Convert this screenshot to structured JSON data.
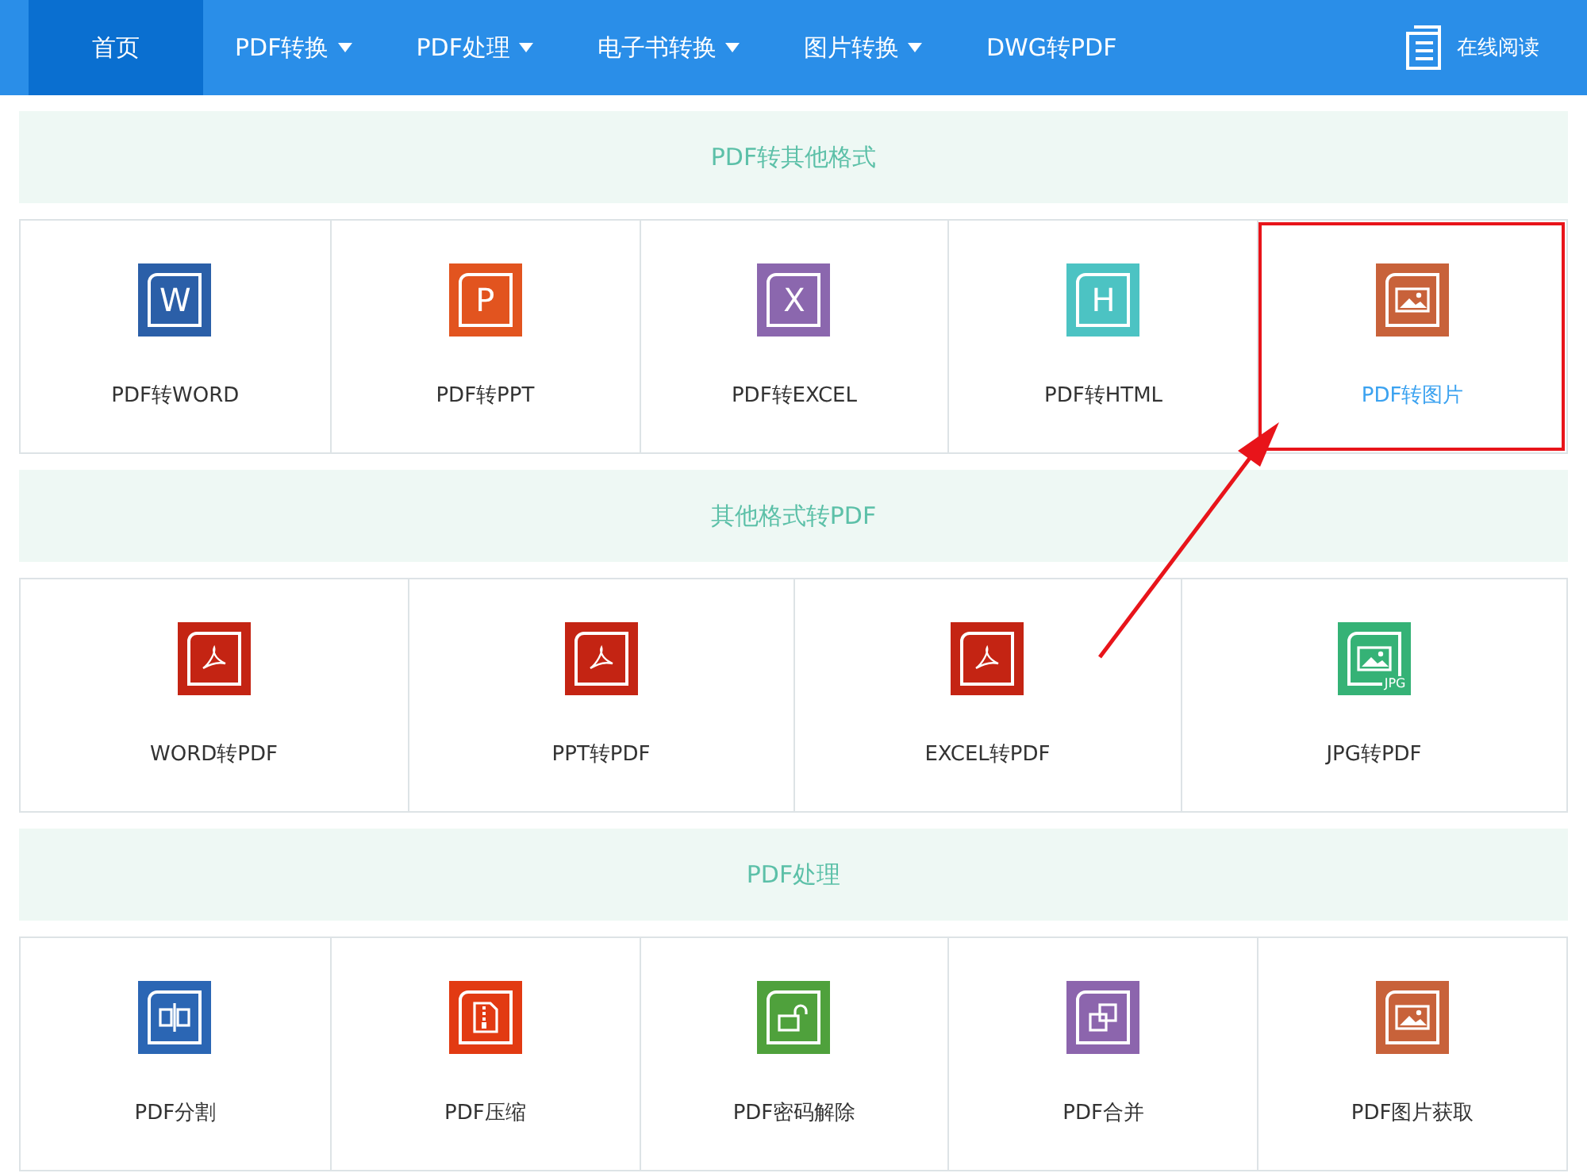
{
  "nav": {
    "items": [
      {
        "label": "首页",
        "selected": true,
        "has_menu": false
      },
      {
        "label": "PDF转换",
        "selected": false,
        "has_menu": true
      },
      {
        "label": "PDF处理",
        "selected": false,
        "has_menu": true
      },
      {
        "label": "电子书转换",
        "selected": false,
        "has_menu": true
      },
      {
        "label": "图片转换",
        "selected": false,
        "has_menu": true
      },
      {
        "label": "DWG转PDF",
        "selected": false,
        "has_menu": false
      }
    ],
    "reader_link": "在线阅读"
  },
  "sections": [
    {
      "title": "PDF转其他格式",
      "tools": [
        {
          "label": "PDF转WORD",
          "kind": "letter",
          "glyph": "W",
          "color": "#2b5fa8",
          "highlighted": false
        },
        {
          "label": "PDF转PPT",
          "kind": "letter",
          "glyph": "P",
          "color": "#e2541f",
          "highlighted": false
        },
        {
          "label": "PDF转EXCEL",
          "kind": "letter",
          "glyph": "X",
          "color": "#8b67ae",
          "highlighted": false
        },
        {
          "label": "PDF转HTML",
          "kind": "letter",
          "glyph": "H",
          "color": "#4cc3c3",
          "highlighted": false
        },
        {
          "label": "PDF转图片",
          "kind": "image",
          "color": "#c8623a",
          "highlighted": true
        }
      ]
    },
    {
      "title": "其他格式转PDF",
      "tools": [
        {
          "label": "WORD转PDF",
          "kind": "pdf",
          "color": "#c42413",
          "highlighted": false
        },
        {
          "label": "PPT转PDF",
          "kind": "pdf",
          "color": "#c42413",
          "highlighted": false
        },
        {
          "label": "EXCEL转PDF",
          "kind": "pdf",
          "color": "#c42413",
          "highlighted": false
        },
        {
          "label": "JPG转PDF",
          "kind": "jpg",
          "glyph": "JPG",
          "color": "#35b276",
          "highlighted": false
        }
      ]
    },
    {
      "title": "PDF处理",
      "tools": [
        {
          "label": "PDF分割",
          "kind": "split",
          "color": "#2b66b4",
          "highlighted": false
        },
        {
          "label": "PDF压缩",
          "kind": "zip",
          "color": "#e23a12",
          "highlighted": false
        },
        {
          "label": "PDF密码解除",
          "kind": "unlock",
          "color": "#4fa13c",
          "highlighted": false
        },
        {
          "label": "PDF合并",
          "kind": "merge",
          "color": "#8c65ad",
          "highlighted": false
        },
        {
          "label": "PDF图片获取",
          "kind": "image",
          "color": "#c8623a",
          "highlighted": false
        }
      ]
    }
  ],
  "annotation": {
    "arrow": true
  }
}
